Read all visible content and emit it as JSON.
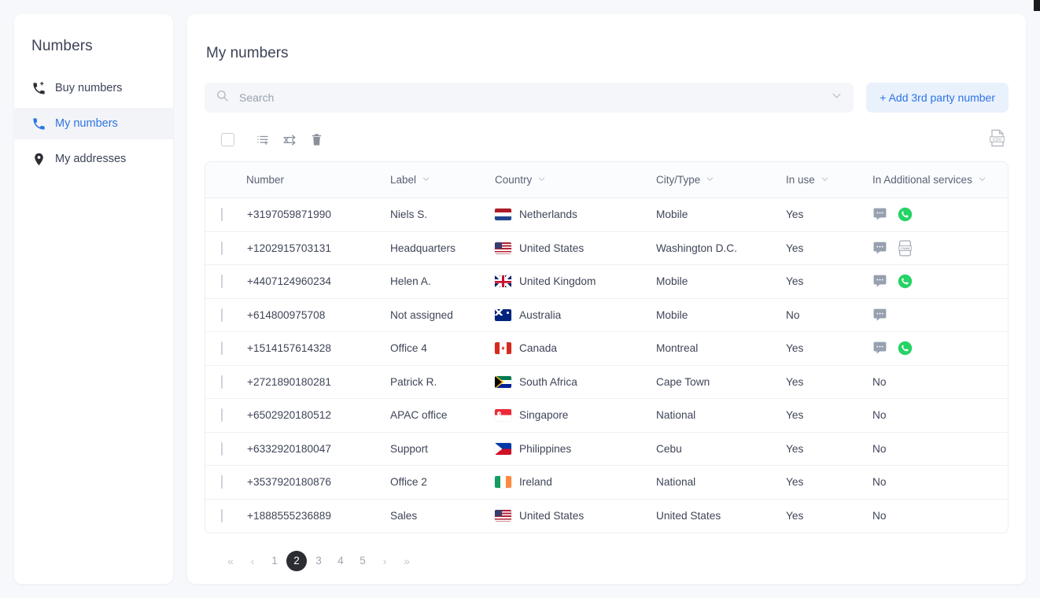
{
  "sidebar": {
    "title": "Numbers",
    "items": [
      {
        "label": "Buy numbers",
        "icon": "phone-plus-icon",
        "active": false
      },
      {
        "label": "My numbers",
        "icon": "phone-icon",
        "active": true
      },
      {
        "label": "My addresses",
        "icon": "map-pin-icon",
        "active": false
      }
    ]
  },
  "main": {
    "title": "My numbers",
    "search": {
      "value": "",
      "placeholder": "Search",
      "icon": "search-icon",
      "chevron": "chevron-down-icon"
    },
    "add_button": {
      "label": "+ Add 3rd party number"
    },
    "toolbar": {
      "select_all_checked": false,
      "actions": [
        {
          "name": "add-to-list-icon",
          "title": "Add to list"
        },
        {
          "name": "shuffle-icon",
          "title": "Reassign"
        },
        {
          "name": "trash-icon",
          "title": "Delete"
        }
      ],
      "export": {
        "name": "csv-export-icon",
        "title": "Export CSV"
      }
    },
    "table": {
      "columns": [
        {
          "key": "number",
          "label": "Number",
          "sortable": false
        },
        {
          "key": "label",
          "label": "Label",
          "sortable": true
        },
        {
          "key": "country",
          "label": "Country",
          "sortable": true
        },
        {
          "key": "city",
          "label": "City/Type",
          "sortable": true
        },
        {
          "key": "inuse",
          "label": "In use",
          "sortable": true
        },
        {
          "key": "svc",
          "label": "In Additional services",
          "sortable": true
        }
      ],
      "rows": [
        {
          "number": "+3197059871990",
          "label": "Niels S.",
          "country": "Netherlands",
          "flag": "nl",
          "city": "Mobile",
          "inuse": "Yes",
          "svc_text": "",
          "svc_icons": [
            "sms-icon",
            "whatsapp-icon"
          ]
        },
        {
          "number": "+1202915703131",
          "label": "Headquarters",
          "country": "United States",
          "flag": "us",
          "city": "Washington D.C.",
          "inuse": "Yes",
          "svc_text": "",
          "svc_icons": [
            "sms-icon",
            "cnam-icon"
          ]
        },
        {
          "number": "+4407124960234",
          "label": "Helen A.",
          "country": "United Kingdom",
          "flag": "gb",
          "city": "Mobile",
          "inuse": "Yes",
          "svc_text": "",
          "svc_icons": [
            "sms-icon",
            "whatsapp-icon"
          ]
        },
        {
          "number": "+614800975708",
          "label": "Not assigned",
          "country": "Australia",
          "flag": "au",
          "city": "Mobile",
          "inuse": "No",
          "svc_text": "",
          "svc_icons": [
            "sms-icon"
          ]
        },
        {
          "number": "+1514157614328",
          "label": "Office 4",
          "country": "Canada",
          "flag": "ca",
          "city": "Montreal",
          "inuse": "Yes",
          "svc_text": "",
          "svc_icons": [
            "sms-icon",
            "whatsapp-icon"
          ]
        },
        {
          "number": "+2721890180281",
          "label": "Patrick R.",
          "country": "South Africa",
          "flag": "za",
          "city": "Cape Town",
          "inuse": "Yes",
          "svc_text": "No",
          "svc_icons": []
        },
        {
          "number": "+6502920180512",
          "label": "APAC office",
          "country": "Singapore",
          "flag": "sg",
          "city": "National",
          "inuse": "Yes",
          "svc_text": "No",
          "svc_icons": []
        },
        {
          "number": "+6332920180047",
          "label": "Support",
          "country": "Philippines",
          "flag": "ph",
          "city": "Cebu",
          "inuse": "Yes",
          "svc_text": "No",
          "svc_icons": []
        },
        {
          "number": "+3537920180876",
          "label": "Office 2",
          "country": "Ireland",
          "flag": "ie",
          "city": "National",
          "inuse": "Yes",
          "svc_text": "No",
          "svc_icons": []
        },
        {
          "number": "+1888555236889",
          "label": "Sales",
          "country": "United States",
          "flag": "us",
          "city": "United States",
          "inuse": "Yes",
          "svc_text": "No",
          "svc_icons": []
        }
      ]
    },
    "pagination": {
      "first": "«",
      "prev": "‹",
      "next": "›",
      "last": "»",
      "pages": [
        "1",
        "2",
        "3",
        "4",
        "5"
      ],
      "current": "2"
    }
  },
  "colors": {
    "accent": "#2f73e4",
    "accent_bg": "#e9f1fd",
    "whatsapp": "#25d366",
    "sms": "#8f98a8",
    "page_bg": "#f7f8fb",
    "panel": "#ffffff",
    "active_page": "#2b2d33"
  }
}
